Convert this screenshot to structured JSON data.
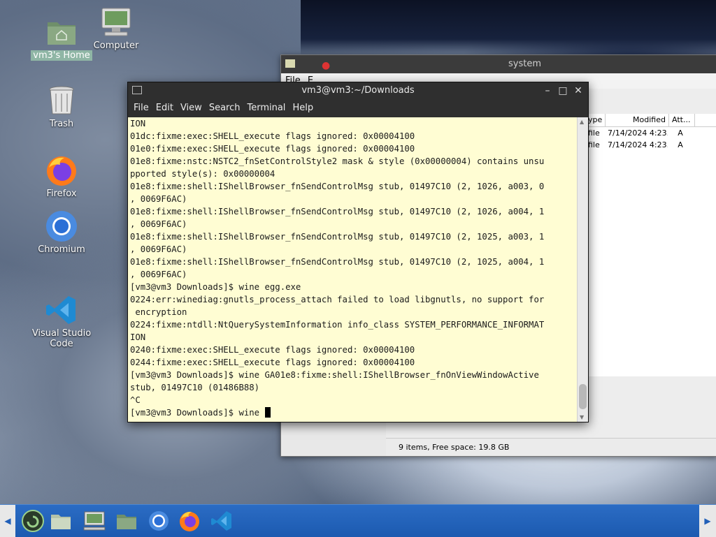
{
  "desktop": {
    "icons": [
      {
        "label": "vm3's Home",
        "icon": "home-folder-icon"
      },
      {
        "label": "Computer",
        "icon": "computer-icon"
      },
      {
        "label": "Trash",
        "icon": "trash-icon"
      },
      {
        "label": "Firefox",
        "icon": "firefox-icon"
      },
      {
        "label": "Chromium",
        "icon": "chromium-icon"
      },
      {
        "label": "Visual Studio Code",
        "icon": "vscode-icon"
      }
    ]
  },
  "file_manager": {
    "title": "system",
    "menu_first": "File",
    "menu_second": "E",
    "columns": [
      "ype",
      "Modified",
      "Att..."
    ],
    "rows": [
      {
        "type": "file",
        "modified": "7/14/2024 4:23...",
        "attr": "A"
      },
      {
        "type": "file",
        "modified": "7/14/2024 4:23...",
        "attr": "A"
      }
    ],
    "status": "9 items, Free space: 19.8 GB"
  },
  "terminal": {
    "title": "vm3@vm3:~/Downloads",
    "menu": [
      "File",
      "Edit",
      "View",
      "Search",
      "Terminal",
      "Help"
    ],
    "lines": [
      "ION",
      "01dc:fixme:exec:SHELL_execute flags ignored: 0x00004100",
      "01e0:fixme:exec:SHELL_execute flags ignored: 0x00004100",
      "01e8:fixme:nstc:NSTC2_fnSetControlStyle2 mask & style (0x00000004) contains unsu",
      "pported style(s): 0x00000004",
      "01e8:fixme:shell:IShellBrowser_fnSendControlMsg stub, 01497C10 (2, 1026, a003, 0",
      ", 0069F6AC)",
      "01e8:fixme:shell:IShellBrowser_fnSendControlMsg stub, 01497C10 (2, 1026, a004, 1",
      ", 0069F6AC)",
      "01e8:fixme:shell:IShellBrowser_fnSendControlMsg stub, 01497C10 (2, 1025, a003, 1",
      ", 0069F6AC)",
      "01e8:fixme:shell:IShellBrowser_fnSendControlMsg stub, 01497C10 (2, 1025, a004, 1",
      ", 0069F6AC)",
      "[vm3@vm3 Downloads]$ wine egg.exe",
      "0224:err:winediag:gnutls_process_attach failed to load libgnutls, no support for",
      " encryption",
      "0224:fixme:ntdll:NtQuerySystemInformation info_class SYSTEM_PERFORMANCE_INFORMAT",
      "ION",
      "0240:fixme:exec:SHELL_execute flags ignored: 0x00004100",
      "0244:fixme:exec:SHELL_execute flags ignored: 0x00004100",
      "[vm3@vm3 Downloads]$ wine GA01e8:fixme:shell:IShellBrowser_fnOnViewWindowActive",
      "stub, 01497C10 (01486B88)",
      "^C"
    ],
    "prompt": "[vm3@vm3 Downloads]$ wine "
  },
  "taskbar": {
    "apps": [
      "start-menu-icon",
      "show-desktop-icon",
      "computer-icon",
      "home-folder-icon",
      "chromium-icon",
      "firefox-icon",
      "vscode-icon"
    ]
  }
}
